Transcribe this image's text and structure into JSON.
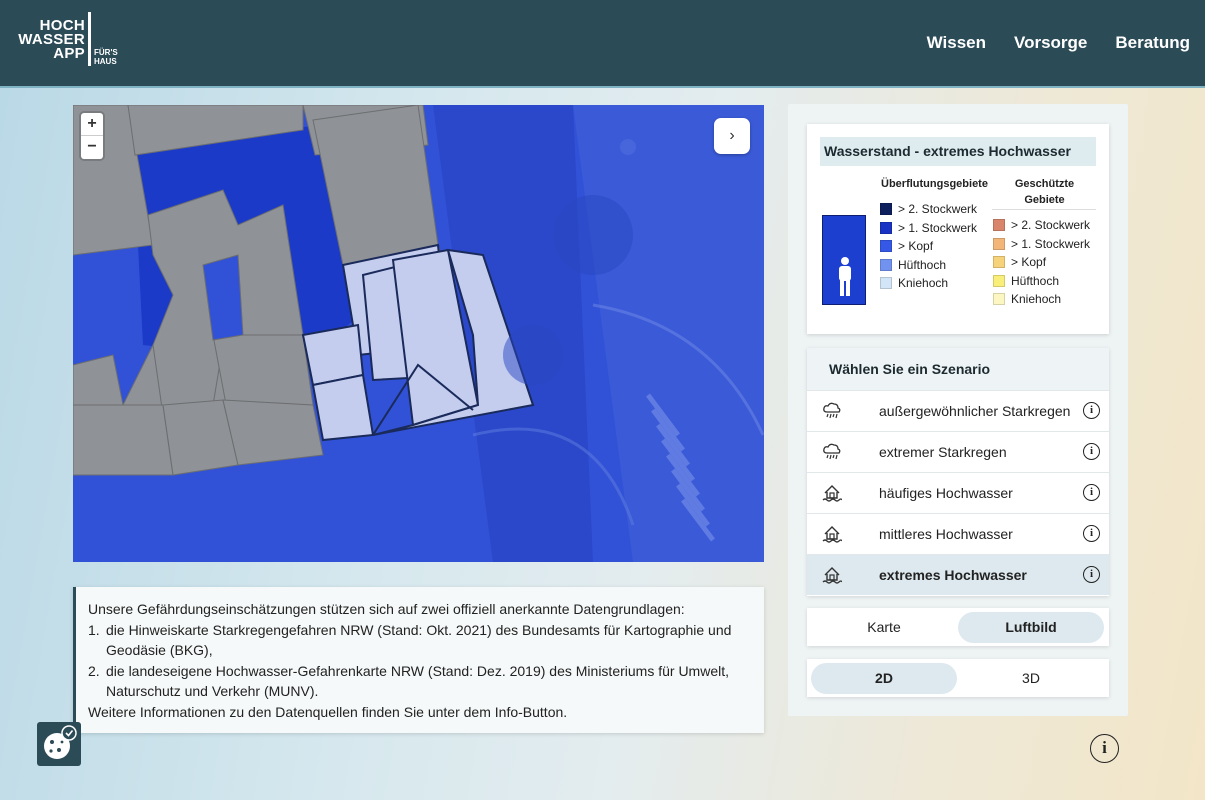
{
  "logo": {
    "line1": "HOCH",
    "line2": "WASSER",
    "line3": "APP",
    "sub1": "FÜR'S",
    "sub2": "HAUS"
  },
  "nav": [
    "Wissen",
    "Vorsorge",
    "Beratung"
  ],
  "map": {
    "zoom_in": "+",
    "zoom_out": "−",
    "toggle_icon": "›"
  },
  "legend": {
    "title": "Wasserstand - extremes Hochwasser",
    "col1_title": "Überflutungsgebiete",
    "col2_title": "Geschützte Gebiete",
    "flood": [
      {
        "label": "> 2. Stockwerk",
        "color": "#0e1f5e"
      },
      {
        "label": "> 1. Stockwerk",
        "color": "#1a33c4"
      },
      {
        "label": "> Kopf",
        "color": "#3559e6"
      },
      {
        "label": "Hüfthoch",
        "color": "#7192ef"
      },
      {
        "label": "Kniehoch",
        "color": "#d3e6f7"
      }
    ],
    "protected": [
      {
        "label": "> 2. Stockwerk",
        "color": "#d9856b"
      },
      {
        "label": "> 1. Stockwerk",
        "color": "#f2b679"
      },
      {
        "label": "> Kopf",
        "color": "#f6d27a"
      },
      {
        "label": "Hüfthoch",
        "color": "#f9ee7a"
      },
      {
        "label": "Kniehoch",
        "color": "#fcf7c2"
      }
    ]
  },
  "scenario": {
    "title": "Wählen Sie ein Szenario",
    "items": [
      {
        "label": "außergewöhnlicher Starkregen",
        "icon": "rain-cloud-icon",
        "active": false
      },
      {
        "label": "extremer Starkregen",
        "icon": "rain-cloud-icon",
        "active": false
      },
      {
        "label": "häufiges Hochwasser",
        "icon": "flooded-house-icon",
        "active": false
      },
      {
        "label": "mittleres Hochwasser",
        "icon": "flooded-house-icon",
        "active": false
      },
      {
        "label": "extremes Hochwasser",
        "icon": "flooded-house-icon",
        "active": true
      }
    ]
  },
  "map_type": {
    "options": [
      "Karte",
      "Luftbild"
    ],
    "selected": "Luftbild"
  },
  "view_mode": {
    "options": [
      "2D",
      "3D"
    ],
    "selected": "2D"
  },
  "info_text": {
    "intro": "Unsere Gefährdungseinschätzungen stützen sich auf zwei offiziell anerkannte Datengrundlagen:",
    "items": [
      {
        "num": "1.",
        "text": "die Hinweiskarte Starkregengefahren NRW (Stand: Okt. 2021) des Bundesamts für Kartographie und Geodäsie (BKG),"
      },
      {
        "num": "2.",
        "text": "die landeseigene Hochwasser-Gefahrenkarte NRW (Stand: Dez. 2019) des Ministeriums für Umwelt, Naturschutz und Verkehr (MUNV)."
      }
    ],
    "outro": "Weitere Informationen zu den Datenquellen finden Sie unter dem Info-Button."
  },
  "info_button": "i"
}
